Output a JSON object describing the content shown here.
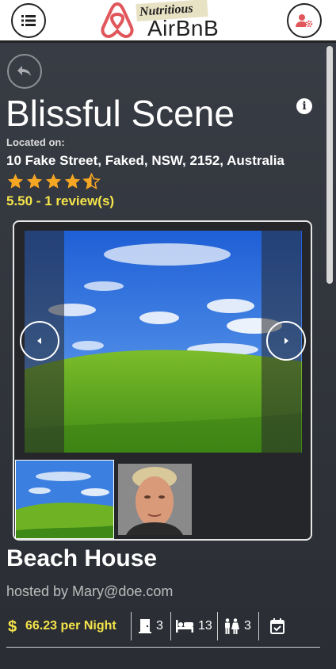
{
  "header": {
    "logo_tagline": "Nutritious",
    "logo_name": "AirBnB"
  },
  "listing": {
    "title": "Blissful Scene",
    "located_label": "Located on:",
    "address": "10 Fake Street, Faked, NSW, 2152, Australia",
    "rating_value": 4.5,
    "rating_max": 5,
    "rating_text": "5.50 - 1 review(s)",
    "property_type": "Beach House",
    "hosted_by": "hosted by Mary@doe.com",
    "price": "66.23 per Night",
    "bedrooms": "3",
    "beds": "13",
    "bathrooms": "3"
  },
  "gallery": {
    "images": [
      "landscape-photo",
      "portrait-photo"
    ]
  },
  "colors": {
    "accent_yellow": "#f5e44a",
    "star_orange": "#f5a623",
    "panel_dark": "#2f3238",
    "logo_red": "#e0565b"
  }
}
